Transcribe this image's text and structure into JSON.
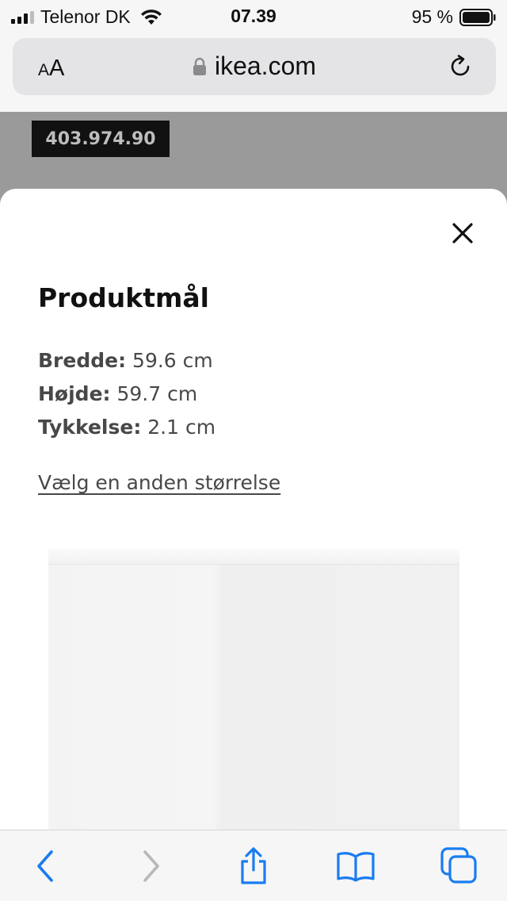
{
  "status_bar": {
    "carrier": "Telenor DK",
    "time": "07.39",
    "battery_percent": "95 %",
    "battery_level": 0.95,
    "signal_bars": 3
  },
  "browser": {
    "text_size_small": "A",
    "text_size_large": "A",
    "url": "ikea.com"
  },
  "page": {
    "article_number": "403.974.90"
  },
  "modal": {
    "title": "Produktmål",
    "dimensions": [
      {
        "label": "Bredde:",
        "value": "59.6 cm"
      },
      {
        "label": "Højde:",
        "value": "59.7 cm"
      },
      {
        "label": "Tykkelse:",
        "value": "2.1 cm"
      }
    ],
    "change_size_link": "Vælg en anden størrelse"
  },
  "colors": {
    "accent_blue": "#1a7cf0",
    "disabled_gray": "#b8b8bc"
  },
  "icons": {
    "toolbar": [
      "back-icon",
      "forward-icon",
      "share-icon",
      "bookmarks-icon",
      "tabs-icon"
    ]
  }
}
